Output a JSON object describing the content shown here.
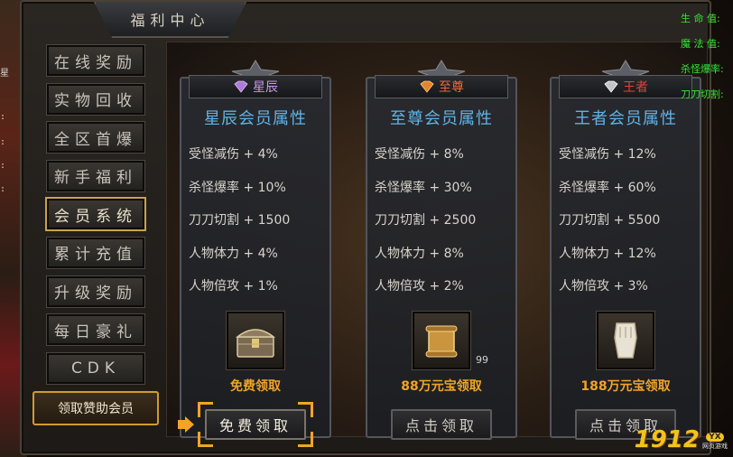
{
  "window": {
    "title": "福利中心"
  },
  "hud": {
    "stats": [
      {
        "label": "生 命 值:"
      },
      {
        "label": "魔 法 值:"
      },
      {
        "label": "杀怪爆率:"
      },
      {
        "label": "刀刀切割:"
      }
    ],
    "left_ticks": [
      "星",
      ":",
      ":",
      ":",
      ":"
    ]
  },
  "nav": {
    "items": [
      {
        "label": "在线奖励"
      },
      {
        "label": "实物回收"
      },
      {
        "label": "全区首爆"
      },
      {
        "label": "新手福利"
      },
      {
        "label": "会员系统",
        "active": true
      },
      {
        "label": "累计充值"
      },
      {
        "label": "升级奖励"
      },
      {
        "label": "每日豪礼"
      },
      {
        "label": "CDK"
      }
    ],
    "claim_sponsor_label": "领取赞助会员"
  },
  "cards": [
    {
      "rank": "星辰",
      "title": "星辰会员属性",
      "attributes": [
        "受怪减伤 + 4%",
        "杀怪爆率 + 10%",
        "刀刀切割 + 1500",
        "人物体力 + 4%",
        "人物倍攻 + 1%"
      ],
      "item_icon": "treasure-chest-icon",
      "item_count": "",
      "price": "免费领取",
      "button": "免费领取"
    },
    {
      "rank": "至尊",
      "title": "至尊会员属性",
      "attributes": [
        "受怪减伤 + 8%",
        "杀怪爆率 + 30%",
        "刀刀切割 + 2500",
        "人物体力 + 8%",
        "人物倍攻 + 2%"
      ],
      "item_icon": "scroll-icon",
      "item_count": "99",
      "price": "88万元宝领取",
      "button": "点击领取"
    },
    {
      "rank": "王者",
      "title": "王者会员属性",
      "attributes": [
        "受怪减伤 + 12%",
        "杀怪爆率 + 60%",
        "刀刀切割 + 5500",
        "人物体力 + 12%",
        "人物倍攻 + 3%"
      ],
      "item_icon": "gauntlet-icon",
      "item_count": "",
      "price": "188万元宝领取",
      "button": "点击领取"
    }
  ],
  "logo": {
    "number": "1912",
    "badge": "YX",
    "sub": "网页游戏"
  },
  "colors": {
    "accent": "#f0a428",
    "title_blue": "#5fb3e6",
    "hud_green": "#32e632"
  }
}
